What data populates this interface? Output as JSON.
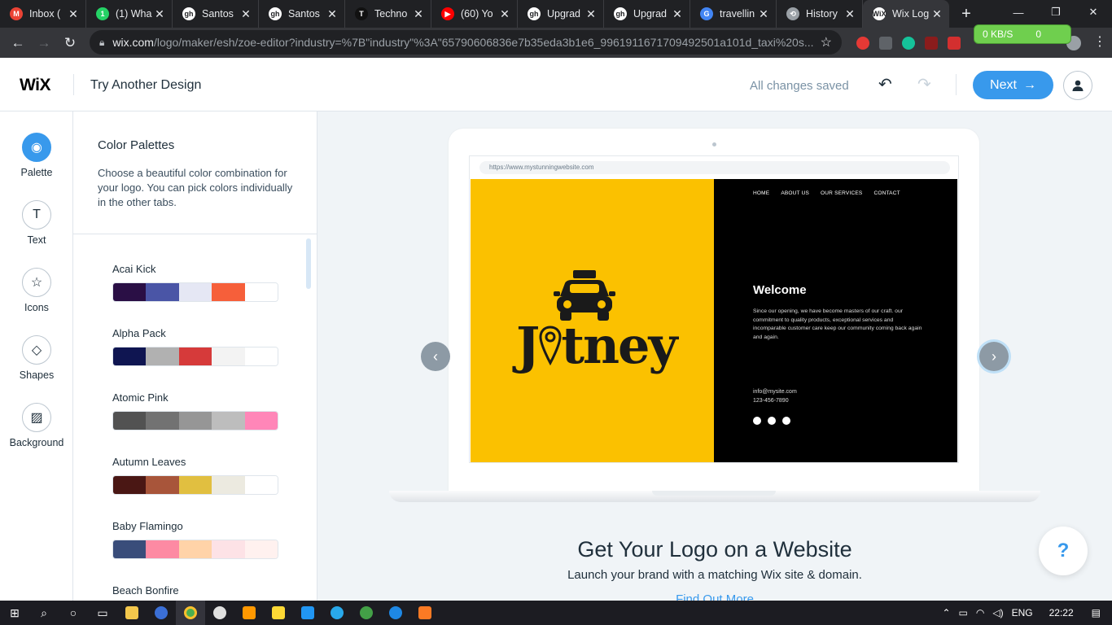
{
  "browser": {
    "tabs": [
      {
        "title": "Inbox (",
        "favicon_color": "#ea4335",
        "favicon": "M"
      },
      {
        "title": "(1) Wha",
        "favicon_color": "#25d366",
        "favicon": "1"
      },
      {
        "title": "Santos",
        "favicon_color": "#ffffff",
        "favicon": "gh"
      },
      {
        "title": "Santos",
        "favicon_color": "#ffffff",
        "favicon": "gh"
      },
      {
        "title": "Techno",
        "favicon_color": "#111111",
        "favicon": "T"
      },
      {
        "title": "(60) Yo",
        "favicon_color": "#ff0000",
        "favicon": "▶"
      },
      {
        "title": "Upgrad",
        "favicon_color": "#ffffff",
        "favicon": "gh"
      },
      {
        "title": "Upgrad",
        "favicon_color": "#ffffff",
        "favicon": "gh"
      },
      {
        "title": "travellin",
        "favicon_color": "#4285f4",
        "favicon": "G"
      },
      {
        "title": "History",
        "favicon_color": "#9aa0a6",
        "favicon": "⟲"
      },
      {
        "title": "Wix Log",
        "favicon_color": "#ffffff",
        "favicon": "WiX",
        "active": true
      }
    ],
    "url_host": "wix.com",
    "url_path": "/logo/maker/esh/zoe-editor?industry=%7B\"industry\"%3A\"65790606836e7b35eda3b1e6_9961911671709492501a101d_taxi%20s...",
    "extension_badge": "0 KB/S",
    "extension_count": "0"
  },
  "header": {
    "logo": "WiX",
    "try_another": "Try Another Design",
    "status": "All changes saved",
    "next_label": "Next"
  },
  "rail": [
    {
      "label": "Palette",
      "icon": "palette-icon",
      "glyph": "◉",
      "active": true
    },
    {
      "label": "Text",
      "icon": "text-icon",
      "glyph": "T"
    },
    {
      "label": "Icons",
      "icon": "star-icon",
      "glyph": "☆"
    },
    {
      "label": "Shapes",
      "icon": "shapes-icon",
      "glyph": "◇"
    },
    {
      "label": "Background",
      "icon": "background-icon",
      "glyph": "▨"
    }
  ],
  "panel": {
    "title": "Color Palettes",
    "description": "Choose a beautiful color combination for your logo. You can pick colors individually in the other tabs.",
    "palettes": [
      {
        "name": "Acai Kick",
        "colors": [
          "#2a0f45",
          "#4a55a6",
          "#e5e7f4",
          "#f65f3a",
          "#ffffff"
        ]
      },
      {
        "name": "Alpha Pack",
        "colors": [
          "#0f1551",
          "#b1b1b1",
          "#d63a3a",
          "#f3f3f3",
          "#ffffff"
        ]
      },
      {
        "name": "Atomic Pink",
        "colors": [
          "#525252",
          "#727272",
          "#969696",
          "#bdbdbd",
          "#ff86b8"
        ]
      },
      {
        "name": "Autumn Leaves",
        "colors": [
          "#4a1714",
          "#a8553a",
          "#e1bf40",
          "#eceae0",
          "#ffffff"
        ]
      },
      {
        "name": "Baby Flamingo",
        "colors": [
          "#394d7a",
          "#fd8aa3",
          "#ffd3a8",
          "#fde2e6",
          "#fff1ef"
        ]
      },
      {
        "name": "Beach Bonfire",
        "colors": [
          "#333333",
          "#666666",
          "#999999",
          "#cccccc",
          "#ffffff"
        ]
      }
    ]
  },
  "preview": {
    "site_url": "https://www.mystunningwebsite.com",
    "nav": [
      "HOME",
      "ABOUT US",
      "OUR SERVICES",
      "CONTACT"
    ],
    "logo_text": "Jitney",
    "welcome": "Welcome",
    "welcome_text": "Since our opening, we have become masters of our craft. our commitment to quality products, exceptional services and incomparable customer care keep our community coming back again and again.",
    "email": "info@mysite.com",
    "phone": "123-456-7890",
    "colors": {
      "left": "#fbc100",
      "right": "#000000"
    }
  },
  "promo": {
    "title": "Get Your Logo on a Website",
    "subtitle": "Launch your brand with a matching Wix site & domain.",
    "link": "Find Out More"
  },
  "help_label": "?",
  "taskbar": {
    "lang": "ENG",
    "time": "22:22"
  },
  "accent": "#3899ec"
}
